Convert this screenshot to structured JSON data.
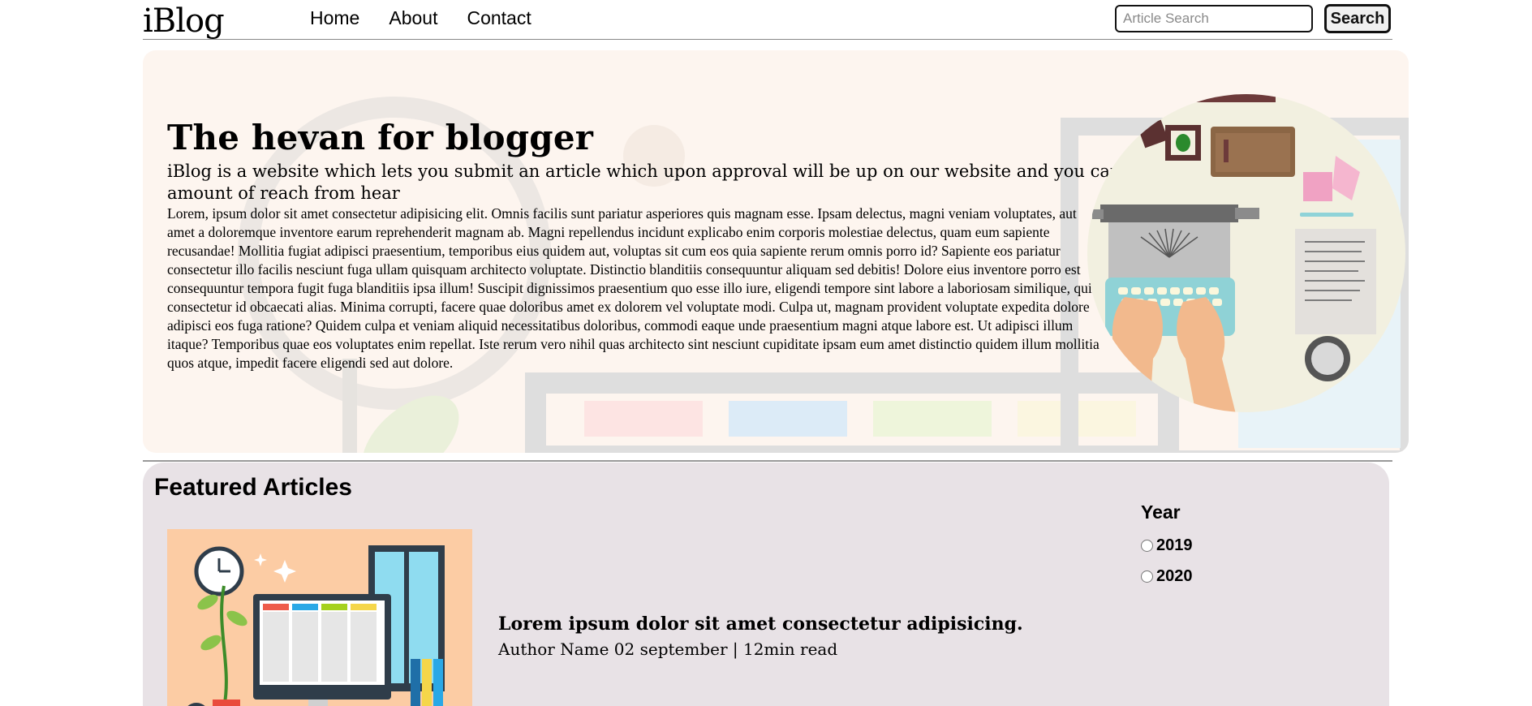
{
  "nav": {
    "logo": "iBlog",
    "links": [
      "Home",
      "About",
      "Contact"
    ],
    "search_placeholder": "Article Search",
    "search_button": "Search"
  },
  "hero": {
    "title": "The hevan for blogger",
    "subtitle": "iBlog is a website which lets you submit an article which upon approval will be up on our website and you can get a good amount of reach from hear",
    "body": "Lorem, ipsum dolor sit amet consectetur adipisicing elit. Omnis facilis sunt pariatur asperiores quis magnam esse. Ipsam delectus, magni veniam voluptates, aut amet a doloremque inventore earum reprehenderit magnam ab. Magni repellendus incidunt explicabo enim corporis molestiae delectus, quam eum sapiente recusandae! Mollitia fugiat adipisci praesentium, temporibus eius quidem aut, voluptas sit cum eos quia sapiente rerum omnis porro id? Sapiente eos pariatur consectetur illo facilis nesciunt fuga ullam quisquam architecto voluptate. Distinctio blanditiis consequuntur aliquam sed debitis! Dolore eius inventore porro est consequuntur tempora fugit fuga blanditiis ipsa illum! Suscipit dignissimos praesentium quo esse illo iure, eligendi tempore sint labore a laboriosam similique, qui consectetur id obcaecati alias. Minima corrupti, facere quae doloribus amet ex dolorem vel voluptate modi. Culpa ut, magnam provident voluptate expedita dolore adipisci eos fuga ratione? Quidem culpa et veniam aliquid necessitatibus doloribus, commodi eaque unde praesentium magni atque labore est. Ut adipisci illum itaque? Temporibus quae eos voluptates enim repellat. Iste rerum vero nihil quas architecto sint nesciunt cupiditate ipsam eum amet distinctio quidem illum mollitia quos atque, impedit facere eligendi sed aut dolore."
  },
  "featured": {
    "heading": "Featured Articles",
    "article": {
      "title": "Lorem ipsum dolor sit amet consectetur adipisicing.",
      "meta": "Author Name 02 september | 12min read"
    },
    "filter": {
      "title": "Year",
      "options": [
        "2019",
        "2020"
      ]
    }
  },
  "colors": {
    "hero_bg": "#fdf5ef",
    "featured_bg": "#e8e2e6"
  }
}
